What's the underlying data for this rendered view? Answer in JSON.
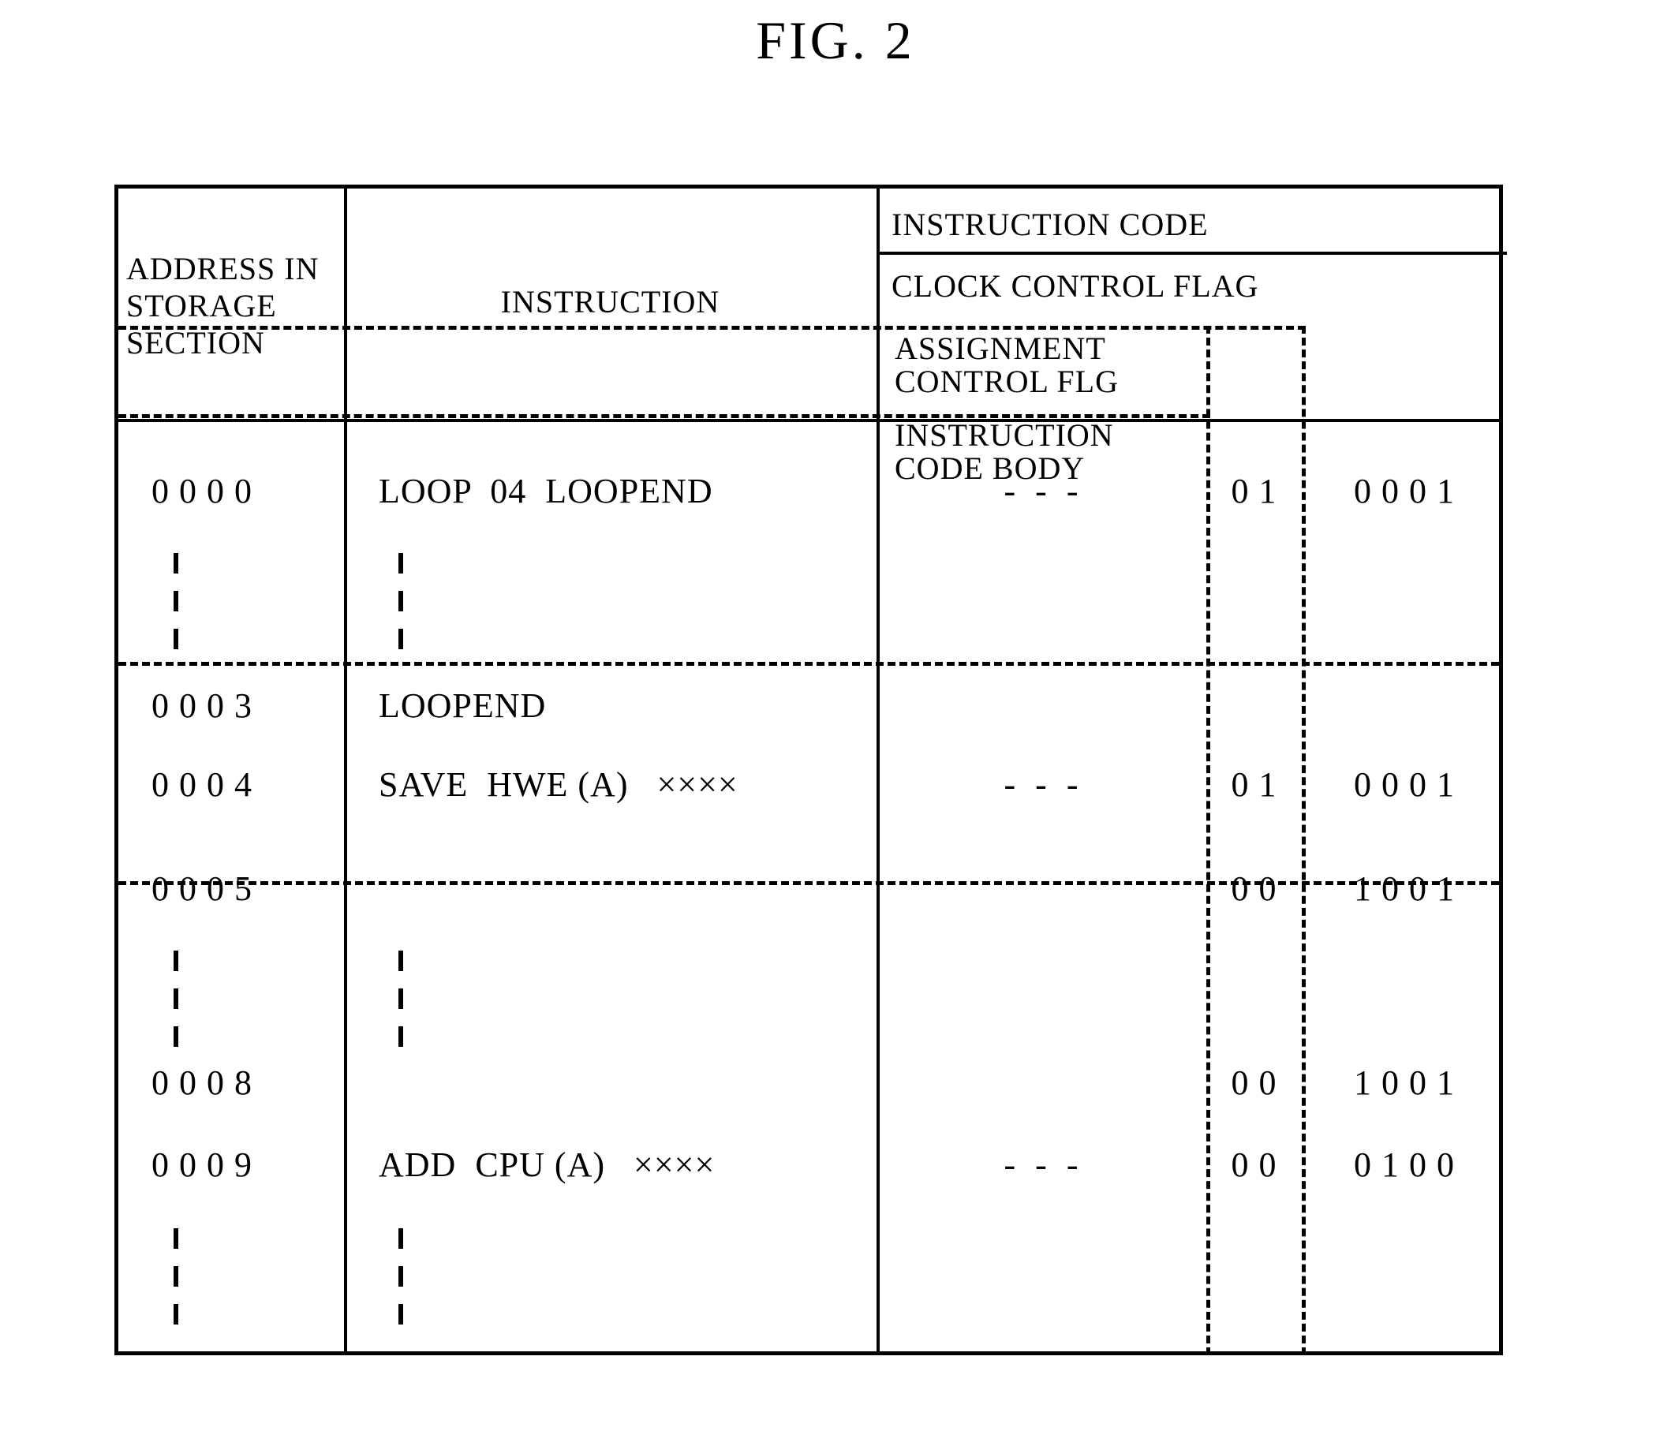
{
  "figure": {
    "title": "FIG. 2"
  },
  "table": {
    "headers": {
      "address": "ADDRESS IN\nSTORAGE\nSECTION",
      "instruction": "INSTRUCTION",
      "instruction_code": "INSTRUCTION CODE",
      "clock_control_flag": "CLOCK CONTROL FLAG",
      "assignment_control_flag": "ASSIGNMENT\nCONTROL FLG",
      "instruction_code_body": "INSTRUCTION\nCODE BODY"
    },
    "rows": [
      {
        "address": "0 0 0 0",
        "instruction": "LOOP  04  LOOPEND",
        "clock": "-  -  -",
        "assignment": "0 1",
        "body": "0 0 0 1"
      },
      {
        "address": "0 0 0 3",
        "instruction": "LOOPEND",
        "clock": "",
        "assignment": "",
        "body": ""
      },
      {
        "address": "0 0 0 4",
        "instruction": "SAVE  HWE (A)   ××××",
        "clock": "-  -  -",
        "assignment": "0 1",
        "body": "0 0 0 1"
      },
      {
        "address": "0 0 0 5",
        "instruction": "",
        "clock": "",
        "assignment": "0 0",
        "body": "1 0 0 1"
      },
      {
        "address": "0 0 0 8",
        "instruction": "",
        "clock": "",
        "assignment": "0 0",
        "body": "1 0 0 1"
      },
      {
        "address": "0 0 0 9",
        "instruction": "ADD  CPU (A)   ××××",
        "clock": "-  -  -",
        "assignment": "0 0",
        "body": "0 1 0 0"
      }
    ]
  },
  "colors": {
    "line": "#000000",
    "background": "#ffffff"
  }
}
